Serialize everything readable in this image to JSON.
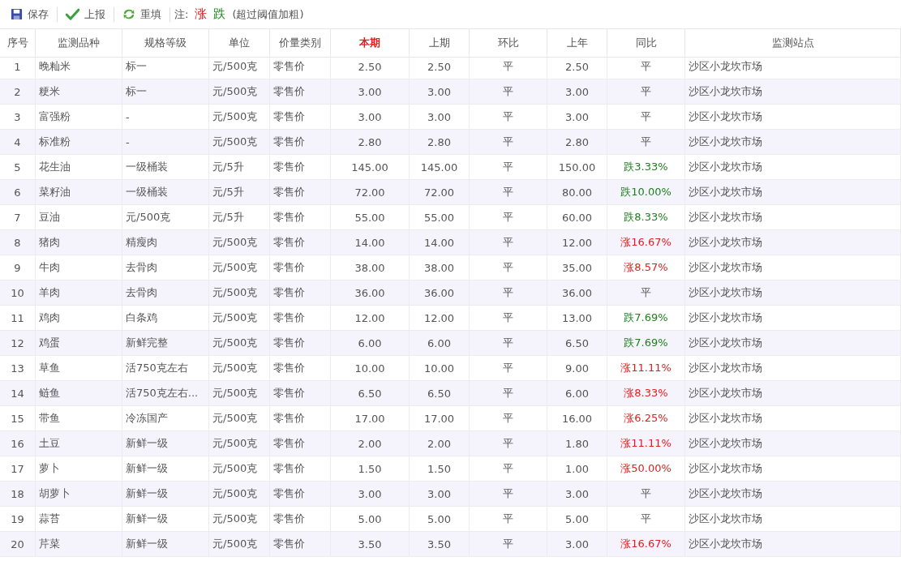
{
  "toolbar": {
    "buttons": [
      {
        "label": "保存",
        "kind": "save"
      },
      {
        "label": "上报",
        "kind": "report"
      },
      {
        "label": "重填",
        "kind": "reset"
      }
    ],
    "legend": {
      "prefix": "注:",
      "items": [
        {
          "text": "涨",
          "color": "#e02020"
        },
        {
          "text": "跌",
          "color": "#1f8a1f"
        }
      ],
      "note": "(超过阈值加粗)"
    }
  },
  "table": {
    "columns": [
      {
        "label": "序号",
        "highlight": false
      },
      {
        "label": "监测品种",
        "highlight": false
      },
      {
        "label": "规格等级",
        "highlight": false
      },
      {
        "label": "单位",
        "highlight": false
      },
      {
        "label": "价量类别",
        "highlight": false
      },
      {
        "label": "本期",
        "highlight": true
      },
      {
        "label": "上期",
        "highlight": false
      },
      {
        "label": "环比",
        "highlight": false
      },
      {
        "label": "上年",
        "highlight": false
      },
      {
        "label": "同比",
        "highlight": false
      },
      {
        "label": "监测站点",
        "highlight": false
      }
    ],
    "rows": [
      {
        "cells": [
          "1",
          "晚籼米",
          "标一",
          "元/500克",
          "零售价",
          "2.50",
          "2.50",
          "平",
          "2.50",
          "平",
          "沙区小龙坎市场"
        ]
      },
      {
        "cells": [
          "2",
          "粳米",
          "标一",
          "元/500克",
          "零售价",
          "3.00",
          "3.00",
          "平",
          "3.00",
          "平",
          "沙区小龙坎市场"
        ]
      },
      {
        "cells": [
          "3",
          "富强粉",
          "-",
          "元/500克",
          "零售价",
          "3.00",
          "3.00",
          "平",
          "3.00",
          "平",
          "沙区小龙坎市场"
        ]
      },
      {
        "cells": [
          "4",
          "标准粉",
          "-",
          "元/500克",
          "零售价",
          "2.80",
          "2.80",
          "平",
          "2.80",
          "平",
          "沙区小龙坎市场"
        ]
      },
      {
        "cells": [
          "5",
          "花生油",
          "一级桶装",
          "元/5升",
          "零售价",
          "145.00",
          "145.00",
          "平",
          "150.00",
          "跌3.33%",
          "沙区小龙坎市场"
        ],
        "color": "#208020"
      },
      {
        "cells": [
          "6",
          "菜籽油",
          "一级桶装",
          "元/5升",
          "零售价",
          "72.00",
          "72.00",
          "平",
          "80.00",
          "跌10.00%",
          "沙区小龙坎市场"
        ],
        "color": "#208020"
      },
      {
        "cells": [
          "7",
          "豆油",
          "元/500克",
          "元/5升",
          "零售价",
          "55.00",
          "55.00",
          "平",
          "60.00",
          "跌8.33%",
          "沙区小龙坎市场"
        ],
        "color": "#208020"
      },
      {
        "cells": [
          "8",
          "猪肉",
          "精瘦肉",
          "元/500克",
          "零售价",
          "14.00",
          "14.00",
          "平",
          "12.00",
          "涨16.67%",
          "沙区小龙坎市场"
        ],
        "color": "#e02020"
      },
      {
        "cells": [
          "9",
          "牛肉",
          "去骨肉",
          "元/500克",
          "零售价",
          "38.00",
          "38.00",
          "平",
          "35.00",
          "涨8.57%",
          "沙区小龙坎市场"
        ],
        "color": "#e02020"
      },
      {
        "cells": [
          "10",
          "羊肉",
          "去骨肉",
          "元/500克",
          "零售价",
          "36.00",
          "36.00",
          "平",
          "36.00",
          "平",
          "沙区小龙坎市场"
        ]
      },
      {
        "cells": [
          "11",
          "鸡肉",
          "白条鸡",
          "元/500克",
          "零售价",
          "12.00",
          "12.00",
          "平",
          "13.00",
          "跌7.69%",
          "沙区小龙坎市场"
        ],
        "color": "#208020"
      },
      {
        "cells": [
          "12",
          "鸡蛋",
          "新鲜完整",
          "元/500克",
          "零售价",
          "6.00",
          "6.00",
          "平",
          "6.50",
          "跌7.69%",
          "沙区小龙坎市场"
        ],
        "color": "#208020"
      },
      {
        "cells": [
          "13",
          "草鱼",
          "活750克左右",
          "元/500克",
          "零售价",
          "10.00",
          "10.00",
          "平",
          "9.00",
          "涨11.11%",
          "沙区小龙坎市场"
        ],
        "color": "#e02020"
      },
      {
        "cells": [
          "14",
          "鲢鱼",
          "活750克左右...",
          "元/500克",
          "零售价",
          "6.50",
          "6.50",
          "平",
          "6.00",
          "涨8.33%",
          "沙区小龙坎市场"
        ],
        "color": "#e02020"
      },
      {
        "cells": [
          "15",
          "带鱼",
          "冷冻国产",
          "元/500克",
          "零售价",
          "17.00",
          "17.00",
          "平",
          "16.00",
          "涨6.25%",
          "沙区小龙坎市场"
        ],
        "color": "#e02020"
      },
      {
        "cells": [
          "16",
          "土豆",
          "新鲜一级",
          "元/500克",
          "零售价",
          "2.00",
          "2.00",
          "平",
          "1.80",
          "涨11.11%",
          "沙区小龙坎市场"
        ],
        "color": "#e02020"
      },
      {
        "cells": [
          "17",
          "萝卜",
          "新鲜一级",
          "元/500克",
          "零售价",
          "1.50",
          "1.50",
          "平",
          "1.00",
          "涨50.00%",
          "沙区小龙坎市场"
        ],
        "color": "#e02020"
      },
      {
        "cells": [
          "18",
          "胡萝卜",
          "新鲜一级",
          "元/500克",
          "零售价",
          "3.00",
          "3.00",
          "平",
          "3.00",
          "平",
          "沙区小龙坎市场"
        ]
      },
      {
        "cells": [
          "19",
          "蒜苔",
          "新鲜一级",
          "元/500克",
          "零售价",
          "5.00",
          "5.00",
          "平",
          "5.00",
          "平",
          "沙区小龙坎市场"
        ]
      },
      {
        "cells": [
          "20",
          "芹菜",
          "新鲜一级",
          "元/500克",
          "零售价",
          "3.50",
          "3.50",
          "平",
          "3.00",
          "涨16.67%",
          "沙区小龙坎市场"
        ],
        "color": "#e02020"
      }
    ]
  }
}
